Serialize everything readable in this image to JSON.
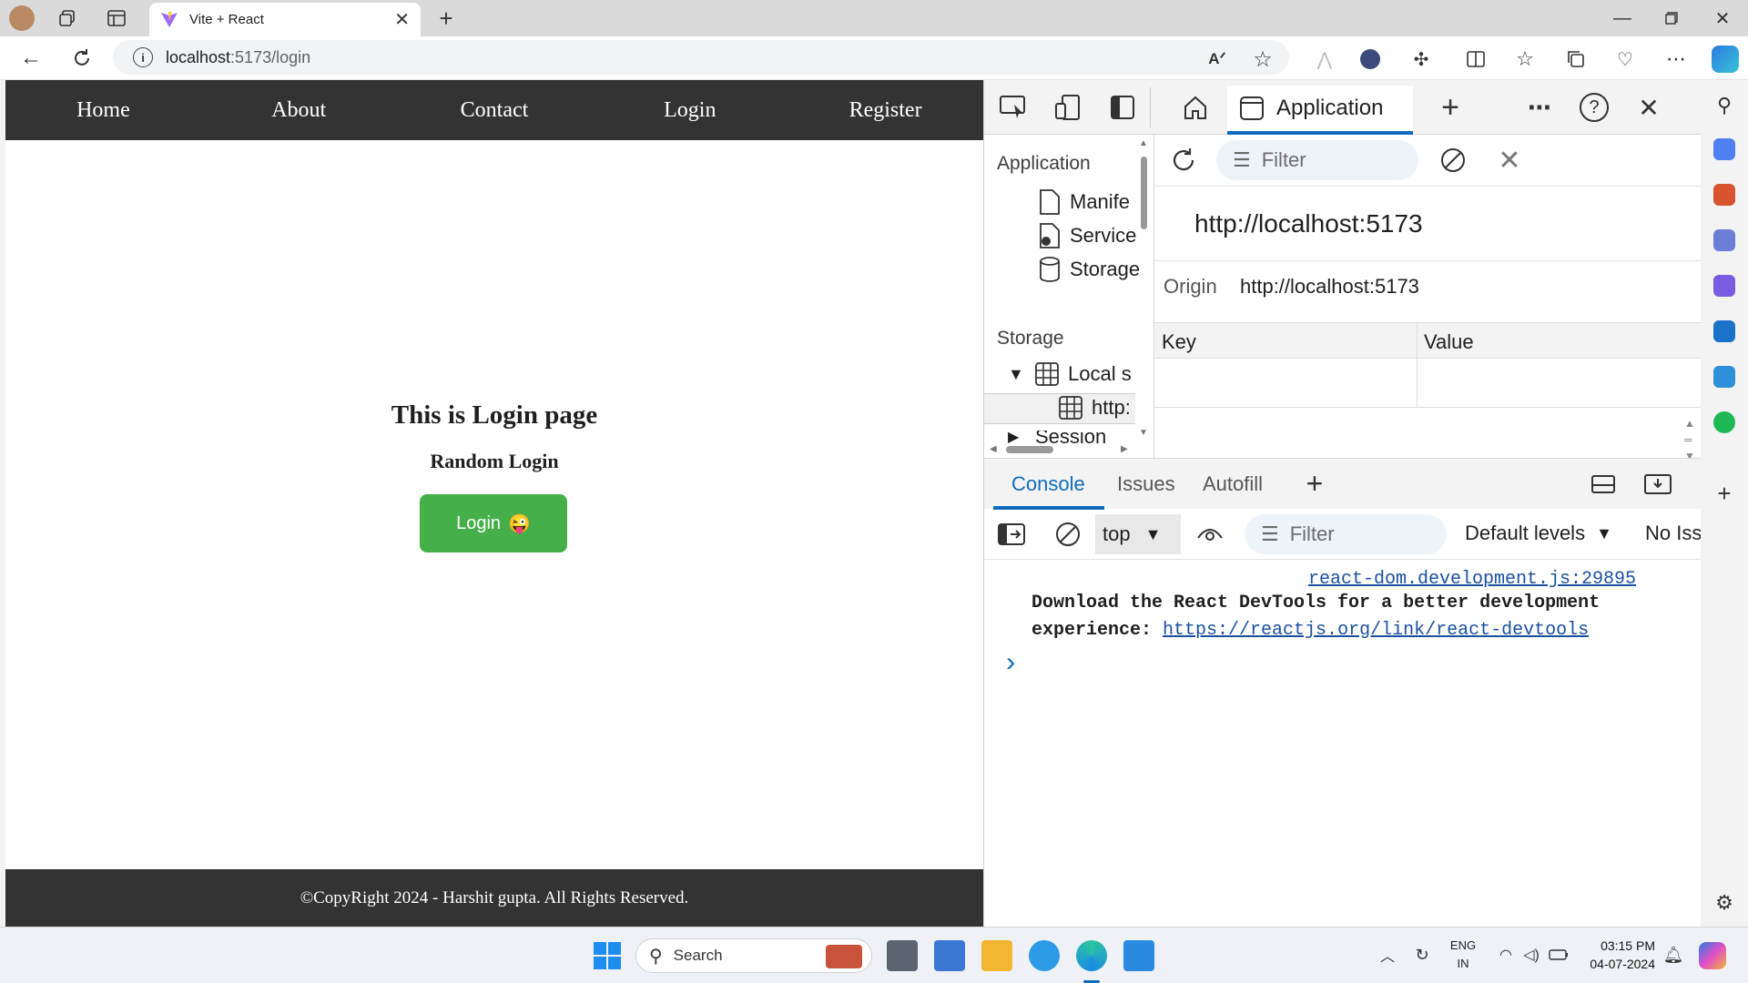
{
  "browser": {
    "tab_title": "Vite + React",
    "url_host": "localhost",
    "url_path": ":5173/login"
  },
  "page": {
    "nav": [
      "Home",
      "About",
      "Contact",
      "Login",
      "Register"
    ],
    "heading": "This is Login page",
    "subheading": "Random Login",
    "login_button": "Login",
    "login_emoji": "😜",
    "footer": "©CopyRight 2024 - Harshit gupta. All Rights Reserved."
  },
  "devtools": {
    "active_tab": "Application",
    "sidebar": {
      "section_application": "Application",
      "items_application": [
        "Manife",
        "Service",
        "Storage"
      ],
      "section_storage": "Storage",
      "local_storage": "Local s",
      "local_storage_child": "http:",
      "session_storage": "Session"
    },
    "pane": {
      "filter_placeholder": "Filter",
      "origin_header": "http://localhost:5173",
      "origin_label": "Origin",
      "origin_value": "http://localhost:5173",
      "col_key": "Key",
      "col_value": "Value"
    },
    "drawer_tabs": [
      "Console",
      "Issues",
      "Autofill"
    ],
    "console": {
      "context": "top",
      "filter_placeholder": "Filter",
      "levels": "Default levels",
      "issues": "No Iss",
      "source_link": "react-dom.development.js:29895",
      "message_line1": "Download the React DevTools for a better development",
      "message_line2_prefix": "experience: ",
      "message_link": "https://reactjs.org/link/react-devtools",
      "prompt": "›"
    }
  },
  "taskbar": {
    "search_placeholder": "Search",
    "lang_line1": "ENG",
    "lang_line2": "IN",
    "time": "03:15 PM",
    "date": "04-07-2024"
  },
  "colors": {
    "navbar": "#333333",
    "login_button": "#45b04a",
    "devtools_accent": "#0f6cbd"
  }
}
